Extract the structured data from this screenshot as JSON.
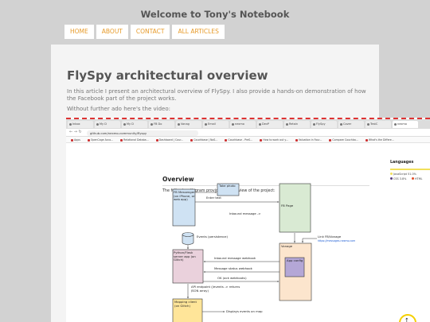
{
  "site": {
    "title": "Welcome to Tony's Notebook"
  },
  "nav": {
    "items": [
      "HOME",
      "ABOUT",
      "CONTACT",
      "ALL ARTICLES"
    ]
  },
  "article": {
    "title": "FlySpy architectural overview",
    "intro": "In this article I present an architectural overview of FlySpy. I also provide a hands-on demonstration of how the Facebook part of the project works.",
    "lead": "Without further ado here's the video:"
  },
  "video": {
    "browser": {
      "tabs": [
        "Inbox",
        "My D",
        "My D",
        "FB Do",
        "Vonag",
        "Email",
        "nexmo",
        "DevP",
        "Retain",
        "FlySpy",
        "Cover",
        "TestC",
        "nexmo"
      ],
      "url": "github.com/nexmo-community/flyspy",
      "bookmarks": [
        "Apps",
        "OpenCage Acco...",
        "Relational Databa...",
        "Dashboard | Cour...",
        "Couchbase | NoS...",
        "Couchbase - PreS...",
        "How to work out y...",
        "Valuation in Four...",
        "Compare Couchba...",
        "What's the Differe..."
      ]
    },
    "page": {
      "heading": "Overview",
      "description": "The following diagram provides an overview of the project:",
      "languages_heading": "Languages",
      "languages": [
        {
          "name": "JavaScript",
          "pct": "51.0%",
          "color": "#f1e05a"
        },
        {
          "name": "CSS",
          "pct": "3.8%",
          "color": "#563d7c"
        },
        {
          "name": "HTML",
          "pct": "",
          "color": "#e34c26"
        }
      ]
    },
    "diagram": {
      "fb_messenger": "FB Messenger (on iPhone, or web app)",
      "take_photo": "Take photo",
      "enter_text": "Enter text",
      "fb_page": "FB Page",
      "inbound_message": "Inbound message ->",
      "events_persistence": "Events (persistence)",
      "link_fb_vonage": "Link FB/Vonage",
      "link_url": "https://messages-nexmo.com",
      "vonage": "Vonage",
      "app_config": "App config",
      "python_flask": "Python/Flask server app (on Glitch)",
      "inbound_webhook": "Inbound message webhook",
      "status_webhook": "Message status webhook",
      "ok_ack": "OK (ack webhooks)",
      "api_endpoint": "API endpoint (/events -> returns JSON array)",
      "mapping_client": "Mapping client (on Glitch)",
      "displays_events": "Displays events on map"
    }
  },
  "colors": {
    "accent": "#e79b2a",
    "video_border": "#dd3333"
  }
}
